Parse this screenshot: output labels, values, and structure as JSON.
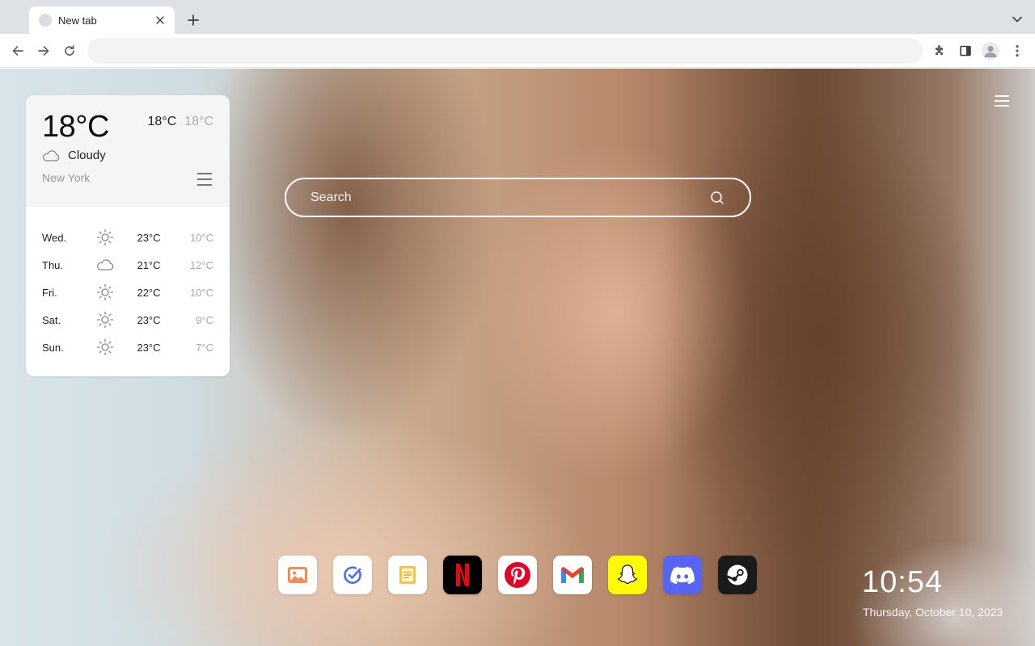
{
  "browser": {
    "tab_title": "New tab",
    "address_value": "",
    "icons": [
      "back-icon",
      "forward-icon",
      "reload-icon",
      "extensions-icon",
      "side-panel-icon",
      "profile-avatar",
      "more-menu-icon"
    ]
  },
  "weather": {
    "current_temp": "18°C",
    "high": "18°C",
    "low": "18°C",
    "condition": "Cloudy",
    "condition_icon": "cloud-icon",
    "city": "New York",
    "forecast": [
      {
        "day": "Wed.",
        "icon": "sun-icon",
        "high": "23°C",
        "low": "10°C"
      },
      {
        "day": "Thu.",
        "icon": "cloud-icon",
        "high": "21°C",
        "low": "12°C"
      },
      {
        "day": "Fri.",
        "icon": "sun-icon",
        "high": "22°C",
        "low": "10°C"
      },
      {
        "day": "Sat.",
        "icon": "sun-icon",
        "high": "23°C",
        "low": "9°C"
      },
      {
        "day": "Sun.",
        "icon": "sun-icon",
        "high": "23°C",
        "low": "7°C"
      }
    ]
  },
  "search": {
    "placeholder": "Search"
  },
  "apps": [
    {
      "name": "photos",
      "icon": "image-icon",
      "bg": "#ffffff"
    },
    {
      "name": "tasks",
      "icon": "check-circle-icon",
      "bg": "#ffffff"
    },
    {
      "name": "notes",
      "icon": "note-icon",
      "bg": "#ffffff"
    },
    {
      "name": "netflix",
      "icon": "netflix-icon",
      "bg": "#000000"
    },
    {
      "name": "pinterest",
      "icon": "pinterest-icon",
      "bg": "#ffffff"
    },
    {
      "name": "gmail",
      "icon": "gmail-icon",
      "bg": "#ffffff"
    },
    {
      "name": "snapchat",
      "icon": "snapchat-icon",
      "bg": "#fffc00"
    },
    {
      "name": "discord",
      "icon": "discord-icon",
      "bg": "#5865f2"
    },
    {
      "name": "steam",
      "icon": "steam-icon",
      "bg": "#1b1b1b"
    }
  ],
  "clock": {
    "time": "10:54",
    "date": "Thursday, October 10, 2023"
  }
}
